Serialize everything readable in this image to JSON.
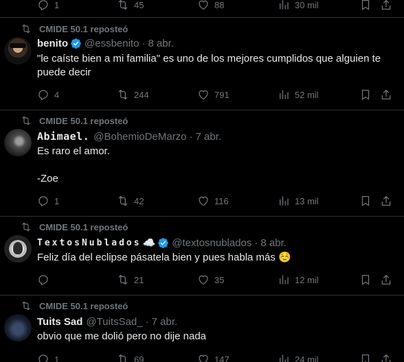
{
  "top_actions": {
    "replies": "1",
    "reposts": "45",
    "likes": "88",
    "views": "30 mil"
  },
  "tweets": [
    {
      "reposted_by": "CMIDE 50.1 reposteó",
      "name": "benito",
      "handle": "@essbenito",
      "date": "8 abr.",
      "verified": true,
      "text": "\"le caíste bien a mi familia\" es uno de los mejores cumplidos que alguien te puede decir",
      "replies": "4",
      "reposts": "244",
      "likes": "791",
      "views": "52 mil"
    },
    {
      "reposted_by": "CMIDE 50.1 reposteó",
      "name": "Abimael.",
      "handle": "@BohemioDeMarzo",
      "date": "7 abr.",
      "verified": false,
      "text_line1": "Es raro el amor.",
      "text_line2": "-Zoe",
      "replies": "1",
      "reposts": "42",
      "likes": "116",
      "views": "13 mil"
    },
    {
      "reposted_by": "CMIDE 50.1 reposteó",
      "name": "TextosNublados",
      "cloud": "☁️",
      "handle": "@textosnublados",
      "date": "8 abr.",
      "verified": true,
      "text": "Feliz día del eclipse pásatela bien y pues habla más ☺️",
      "replies": "",
      "reposts": "21",
      "likes": "35",
      "views": "12 mil"
    },
    {
      "reposted_by": "CMIDE 50.1 reposteó",
      "name": "Tuits Sad",
      "handle": "@TuitsSad_",
      "date": "7 abr.",
      "verified": false,
      "text": "obvio que me dolió pero no dije nada",
      "replies": "1",
      "reposts": "69",
      "likes": "147",
      "views": "24 mil"
    }
  ],
  "dot": "·",
  "colors": {
    "background": "#000000",
    "text": "#e7e9ea",
    "muted": "#71767b",
    "divider": "#2f3336",
    "verified": "#1d9bf0"
  }
}
